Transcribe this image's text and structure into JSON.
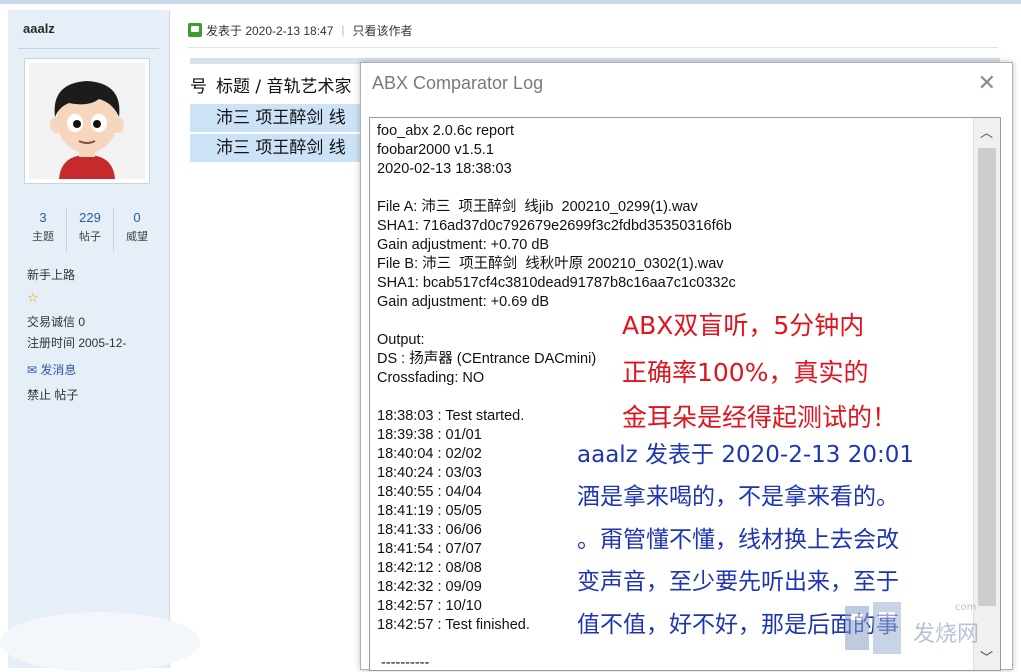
{
  "profile": {
    "username": "aaalz",
    "stats": [
      {
        "value": "3",
        "label": "主题"
      },
      {
        "value": "229",
        "label": "帖子"
      },
      {
        "value": "0",
        "label": "威望"
      }
    ],
    "rank": "新手上路",
    "trust": "交易诚信 0",
    "reg_time": "注册时间  2005-12-",
    "pm": "发消息",
    "ban": "禁止 帖子"
  },
  "post": {
    "posted_at": "发表于 2020-2-13 18:47",
    "only_author": "只看该作者"
  },
  "bg_table": {
    "col_num": "号",
    "col_title": "标题 / 音轨艺术家",
    "rows": [
      "沛三  项王醉剑  线",
      "沛三  项王醉剑  线"
    ]
  },
  "dialog": {
    "title": "ABX Comparator Log",
    "close": "✕",
    "log_lines": [
      "foo_abx 2.0.6c report",
      "foobar2000 v1.5.1",
      "2020-02-13 18:38:03",
      "",
      "File A: 沛三  项王醉剑  线jib  200210_0299(1).wav",
      "SHA1: 716ad37d0c792679e2699f3c2fdbd35350316f6b",
      "Gain adjustment: +0.70 dB",
      "File B: 沛三  项王醉剑  线秋叶原 200210_0302(1).wav",
      "SHA1: bcab517cf4c3810dead91787b8c16aa7c1c0332c",
      "Gain adjustment: +0.69 dB",
      "",
      "Output:",
      "DS : 扬声器 (CEntrance DACmini)",
      "Crossfading: NO",
      "",
      "18:38:03 : Test started.",
      "18:39:38 : 01/01",
      "18:40:04 : 02/02",
      "18:40:24 : 03/03",
      "18:40:55 : 04/04",
      "18:41:19 : 05/05",
      "18:41:33 : 06/06",
      "18:41:54 : 07/07",
      "18:42:12 : 08/08",
      "18:42:32 : 09/09",
      "18:42:57 : 10/10",
      "18:42:57 : Test finished.",
      "",
      " ----------"
    ]
  },
  "annotation_red": [
    "ABX双盲听，5分钟内",
    "正确率100%，真实的",
    "金耳朵是经得起测试的！"
  ],
  "annotation_blue": [
    "aaalz 发表于 2020-2-13 20:01",
    "酒是拿来喝的，不是拿来看的。",
    "。甭管懂不懂，线材换上去会改",
    "变声音，至少要先听出来，至于",
    "值不值，好不好，那是后面的事"
  ],
  "watermark": "发烧网",
  "watermark_small": "com",
  "colors": {
    "red_note": "#e0141e",
    "blue_note": "#1d35b4",
    "link": "#2b5aa6",
    "highlight_row": "#cce3f7"
  }
}
